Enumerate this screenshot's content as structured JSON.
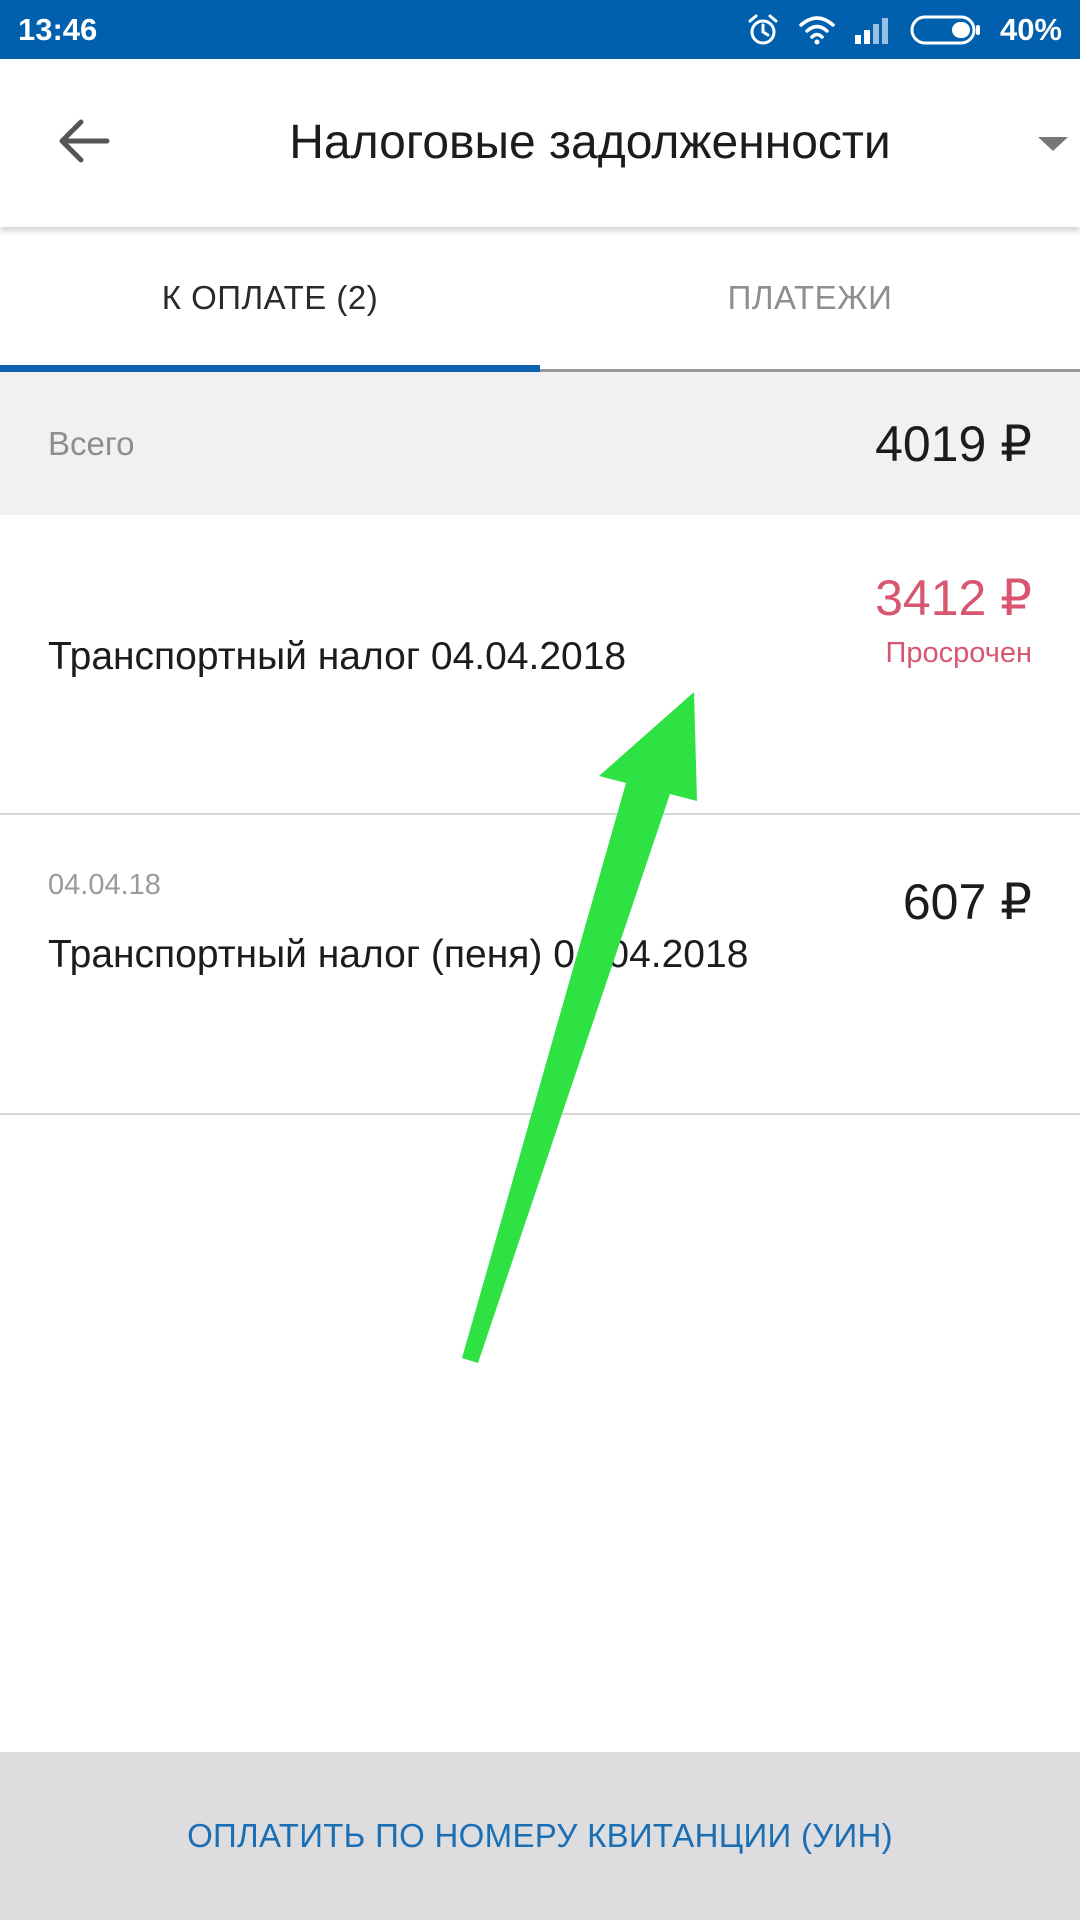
{
  "status_bar": {
    "time": "13:46",
    "battery": "40%",
    "battery_level": 0.4,
    "icons": [
      "alarm-icon",
      "wifi-icon",
      "signal-icon",
      "battery-icon"
    ]
  },
  "app_bar": {
    "title": "Налоговые задолженности",
    "back_icon": "arrow-left-icon",
    "menu_icon": "caret-down-icon"
  },
  "tabs": [
    {
      "label": "К ОПЛАТЕ (2)",
      "active": true
    },
    {
      "label": "ПЛАТЕЖИ",
      "active": false
    }
  ],
  "summary": {
    "label": "Всего",
    "total": "4019 ₽"
  },
  "debts": [
    {
      "name": "Транспортный налог 04.04.2018",
      "amount": "3412 ₽",
      "status": "Просрочен"
    },
    {
      "date": "04.04.18",
      "name": "Транспортный налог (пеня) 04.04.2018",
      "amount": "607 ₽"
    }
  ],
  "footer": {
    "pay_button_label": "ОПЛАТИТЬ ПО НОМЕРУ КВИТАНЦИИ (УИН)"
  },
  "colors": {
    "brand": "#0060ae",
    "accent": "#0e63b0",
    "overdue": "#d95670",
    "annotation": "#2ee244"
  }
}
